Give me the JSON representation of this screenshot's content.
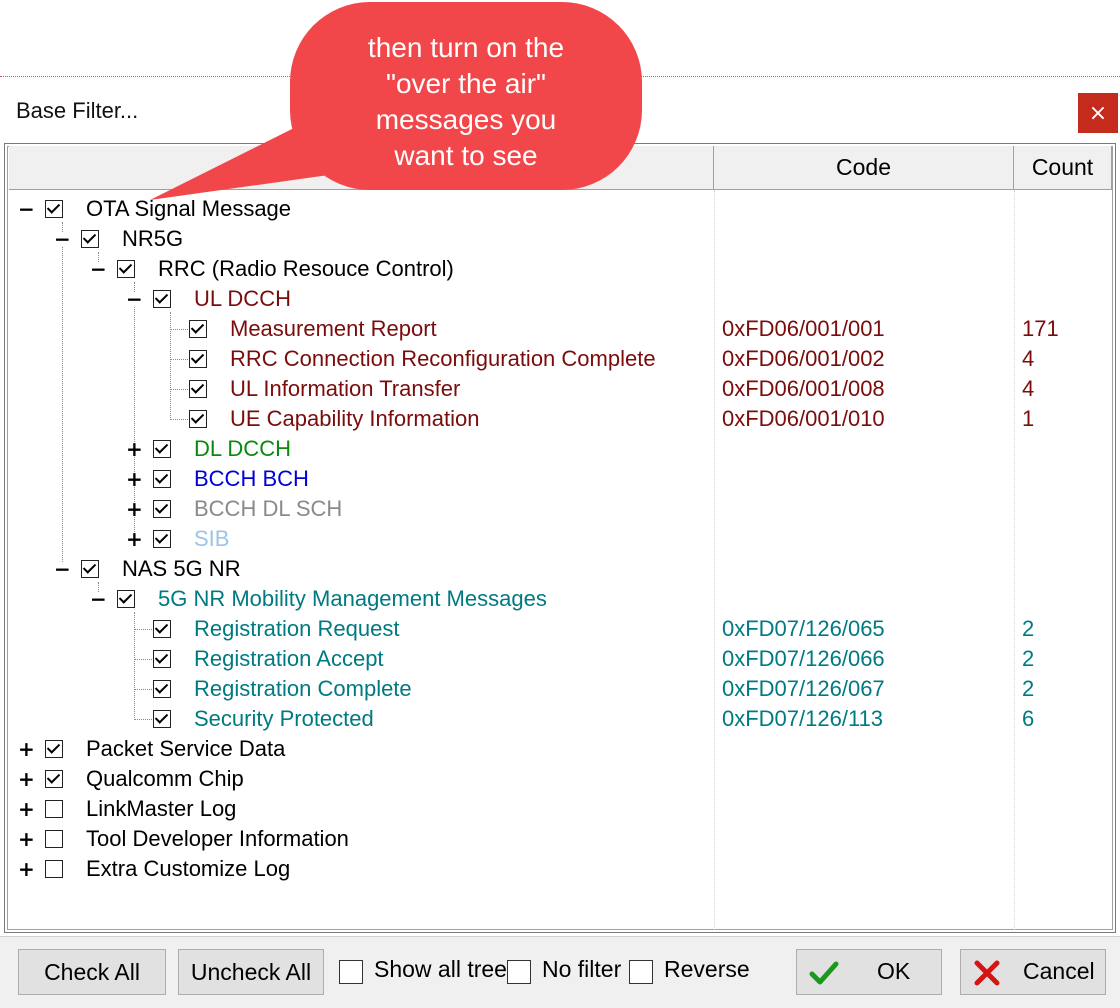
{
  "window": {
    "title": "Base Filter...",
    "close_label": "×"
  },
  "callout": {
    "lines": [
      "then turn on the",
      "\"over the air\"",
      "messages you",
      "want to see"
    ]
  },
  "columns": {
    "name": "",
    "code": "Code",
    "count": "Count"
  },
  "tree": [
    {
      "label": "OTA Signal Message",
      "checked": true,
      "expander": "−",
      "code": "",
      "count": ""
    },
    {
      "label": "NR5G",
      "checked": true,
      "expander": "−",
      "code": "",
      "count": ""
    },
    {
      "label": "RRC (Radio Resouce Control)",
      "checked": true,
      "expander": "−",
      "code": "",
      "count": ""
    },
    {
      "label": "UL DCCH",
      "checked": true,
      "expander": "−",
      "code": "",
      "count": ""
    },
    {
      "label": "Measurement Report",
      "checked": true,
      "expander": "",
      "code": "0xFD06/001/001",
      "count": "171"
    },
    {
      "label": "RRC Connection Reconfiguration Complete",
      "checked": true,
      "expander": "",
      "code": "0xFD06/001/002",
      "count": "4"
    },
    {
      "label": "UL Information Transfer",
      "checked": true,
      "expander": "",
      "code": "0xFD06/001/008",
      "count": "4"
    },
    {
      "label": "UE Capability Information",
      "checked": true,
      "expander": "",
      "code": "0xFD06/001/010",
      "count": "1"
    },
    {
      "label": "DL DCCH",
      "checked": true,
      "expander": "+",
      "code": "",
      "count": ""
    },
    {
      "label": "BCCH BCH",
      "checked": true,
      "expander": "+",
      "code": "",
      "count": ""
    },
    {
      "label": "BCCH DL SCH",
      "checked": true,
      "expander": "+",
      "code": "",
      "count": ""
    },
    {
      "label": "SIB",
      "checked": true,
      "expander": "+",
      "code": "",
      "count": ""
    },
    {
      "label": "NAS 5G NR",
      "checked": true,
      "expander": "−",
      "code": "",
      "count": ""
    },
    {
      "label": "5G NR Mobility Management Messages",
      "checked": true,
      "expander": "−",
      "code": "",
      "count": ""
    },
    {
      "label": "Registration Request",
      "checked": true,
      "expander": "",
      "code": "0xFD07/126/065",
      "count": "2"
    },
    {
      "label": "Registration Accept",
      "checked": true,
      "expander": "",
      "code": "0xFD07/126/066",
      "count": "2"
    },
    {
      "label": "Registration Complete",
      "checked": true,
      "expander": "",
      "code": "0xFD07/126/067",
      "count": "2"
    },
    {
      "label": "Security Protected",
      "checked": true,
      "expander": "",
      "code": "0xFD07/126/113",
      "count": "6"
    },
    {
      "label": "Packet Service Data",
      "checked": true,
      "expander": "+",
      "code": "",
      "count": ""
    },
    {
      "label": "Qualcomm Chip",
      "checked": true,
      "expander": "+",
      "code": "",
      "count": ""
    },
    {
      "label": "LinkMaster Log",
      "checked": false,
      "expander": "+",
      "code": "",
      "count": ""
    },
    {
      "label": "Tool Developer Information",
      "checked": false,
      "expander": "+",
      "code": "",
      "count": ""
    },
    {
      "label": "Extra Customize Log",
      "checked": false,
      "expander": "+",
      "code": "",
      "count": ""
    }
  ],
  "footer": {
    "check_all": "Check All",
    "uncheck_all": "Uncheck All",
    "show_all_tree": "Show all tree",
    "no_filter": "No filter",
    "reverse": "Reverse",
    "ok": "OK",
    "cancel": "Cancel"
  },
  "icons": {
    "ok": "green-checkmark-icon",
    "cancel": "red-x-icon",
    "close": "close-icon"
  },
  "colors": {
    "close_bg": "#c42b1c",
    "callout": "#f2474a",
    "ul_dcch": "#7a0c0c",
    "dl_dcch": "#0a8a0a",
    "bcch_bch": "#0000d8",
    "bcch_dl_sch": "#8a8a8a",
    "sib": "#9ec3e6",
    "nas_mm": "#007a82"
  }
}
